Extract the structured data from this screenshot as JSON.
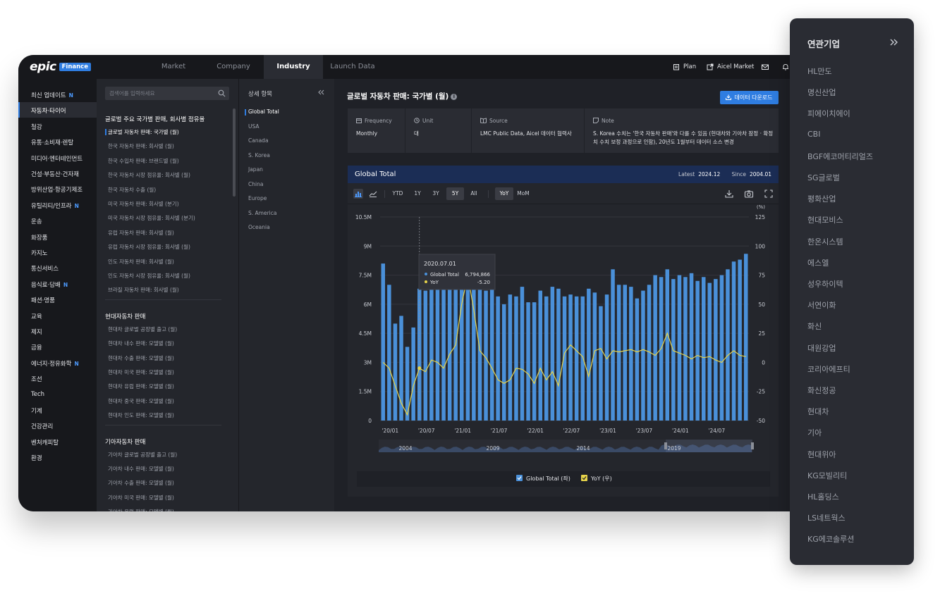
{
  "brand": {
    "name": "epic",
    "badge": "Finance"
  },
  "nav": {
    "tabs": [
      "Market",
      "Company",
      "Industry",
      "Launch Data"
    ]
  },
  "top_right": {
    "plan": "Plan",
    "aicel_market": "Aicel Market"
  },
  "left_menu": {
    "items": [
      {
        "label": "최신 업데이트",
        "badge": "N"
      },
      {
        "label": "자동차·타이어",
        "badge": ""
      },
      {
        "label": "철강",
        "badge": ""
      },
      {
        "label": "유통·소비재·렌탈",
        "badge": ""
      },
      {
        "label": "미디어·엔터테인먼트",
        "badge": ""
      },
      {
        "label": "건설·부동산·건자재",
        "badge": ""
      },
      {
        "label": "방위산업·항공기제조",
        "badge": ""
      },
      {
        "label": "유틸리티/인프라",
        "badge": "N"
      },
      {
        "label": "운송",
        "badge": ""
      },
      {
        "label": "화장품",
        "badge": ""
      },
      {
        "label": "카지노",
        "badge": ""
      },
      {
        "label": "통신서비스",
        "badge": ""
      },
      {
        "label": "음식료·담배",
        "badge": "N"
      },
      {
        "label": "패션·명품",
        "badge": ""
      },
      {
        "label": "교육",
        "badge": ""
      },
      {
        "label": "제지",
        "badge": ""
      },
      {
        "label": "금융",
        "badge": ""
      },
      {
        "label": "에너지·정유화학",
        "badge": "N"
      },
      {
        "label": "조선",
        "badge": ""
      },
      {
        "label": "Tech",
        "badge": ""
      },
      {
        "label": "기계",
        "badge": ""
      },
      {
        "label": "건강관리",
        "badge": ""
      },
      {
        "label": "벤처캐피탈",
        "badge": ""
      },
      {
        "label": "환경",
        "badge": ""
      }
    ]
  },
  "search": {
    "placeholder": "검색어를 입력하세요"
  },
  "list_groups": [
    {
      "title": "글로벌 주요 국가별 판매, 회사별 점유율",
      "items": [
        "글로벌 자동차 판매: 국가별 (월)",
        "한국 자동차 판매: 회사별 (월)",
        "한국 수입차 판매: 브랜드별 (월)",
        "한국 자동차 시장 점유율: 회사별 (월)",
        "한국 자동차 수출 (월)",
        "미국 자동차 판매: 회사별 (분기)",
        "미국 자동차 시장 점유율: 회사별 (분기)",
        "유럽 자동차 판매: 회사별 (월)",
        "유럽 자동차 시장 점유율: 회사별 (월)",
        "인도 자동차 판매: 회사별 (월)",
        "인도 자동차 시장 점유율: 회사별 (월)",
        "브라질 자동차 판매: 회사별 (월)"
      ]
    },
    {
      "title": "현대자동차 판매",
      "items": [
        "현대차 글로벌 공장별 출고 (월)",
        "현대차 내수 판매: 모델별 (월)",
        "현대차 수출 판매: 모델별 (월)",
        "현대차 미국 판매: 모델별 (월)",
        "현대차 유럽 판매: 모델별 (월)",
        "현대차 중국 판매: 모델별 (월)",
        "현대차 인도 판매: 모델별 (월)"
      ]
    },
    {
      "title": "기아자동차 판매",
      "items": [
        "기아차 글로벌 공장별 출고 (월)",
        "기아차 내수 판매: 모델별 (월)",
        "기아차 수출 판매: 모델별 (월)",
        "기아차 미국 판매: 모델별 (월)",
        "기아차 유럽 판매: 모델별 (월)"
      ]
    }
  ],
  "detail": {
    "title": "상세 항목",
    "items": [
      "Global Total",
      "USA",
      "Canada",
      "S. Korea",
      "Japan",
      "China",
      "Europe",
      "S. America",
      "Oceania"
    ]
  },
  "main": {
    "title": "글로벌 자동차 판매: 국가별 (월)",
    "info": "i",
    "download": "데이터 다운로드",
    "meta": [
      {
        "label": "Frequency",
        "value": "Monthly"
      },
      {
        "label": "Unit",
        "value": "대"
      },
      {
        "label": "Source",
        "value": "LMC Public Data, Aicel 데이터 협력사"
      },
      {
        "label": "Note",
        "value": "S. Korea 수치는 '한국 자동차 판매'와 다를 수 있음 (현대차와 기아차 잠정 · 확정",
        "value2": "치 수치 보정 과정으로 인함), 20년도 1월부터 데이터 소스 변경"
      }
    ]
  },
  "chart_header": {
    "title": "Global Total",
    "latest_label": "Latest",
    "latest": "2024.12",
    "since_label": "Since",
    "since": "2004.01"
  },
  "toolbar": {
    "ranges": [
      "YTD",
      "1Y",
      "3Y",
      "5Y",
      "All"
    ],
    "modes": [
      "YoY",
      "MoM"
    ]
  },
  "chart_data": {
    "type": "bar",
    "categories": [
      "2020-01",
      "2020-02",
      "2020-03",
      "2020-04",
      "2020-05",
      "2020-06",
      "2020-07",
      "2020-08",
      "2020-09",
      "2020-10",
      "2020-11",
      "2020-12",
      "2021-01",
      "2021-02",
      "2021-03",
      "2021-04",
      "2021-05",
      "2021-06",
      "2021-07",
      "2021-08",
      "2021-09",
      "2021-10",
      "2021-11",
      "2021-12",
      "2022-01",
      "2022-02",
      "2022-03",
      "2022-04",
      "2022-05",
      "2022-06",
      "2022-07",
      "2022-08",
      "2022-09",
      "2022-10",
      "2022-11",
      "2022-12",
      "2023-01",
      "2023-02",
      "2023-03",
      "2023-04",
      "2023-05",
      "2023-06",
      "2023-07",
      "2023-08",
      "2023-09",
      "2023-10",
      "2023-11",
      "2023-12",
      "2024-01",
      "2024-02",
      "2024-03",
      "2024-04",
      "2024-05",
      "2024-06",
      "2024-07",
      "2024-08",
      "2024-09",
      "2024-10",
      "2024-11",
      "2024-12"
    ],
    "x_tick_labels": [
      "'20/01",
      "'20/07",
      "'21/01",
      "'21/07",
      "'22/01",
      "'22/07",
      "'23/01",
      "'23/07",
      "'24/01",
      "'24/07"
    ],
    "series": [
      {
        "name": "Global Total",
        "axis": "left",
        "values": [
          8100000,
          7000000,
          5000000,
          5400000,
          3800000,
          4800000,
          6800000,
          6700000,
          6900000,
          7000000,
          7300000,
          7000000,
          7100000,
          6900000,
          7300000,
          7000000,
          8200000,
          6700000,
          6900000,
          6400000,
          6000000,
          6500000,
          6400000,
          6900000,
          6100000,
          6100000,
          6700000,
          6400000,
          6900000,
          6800000,
          6400000,
          6500000,
          6400000,
          6400000,
          6800000,
          6600000,
          5900000,
          6500000,
          7800000,
          7000000,
          7000000,
          6900000,
          6300000,
          6700000,
          7000000,
          7500000,
          7400000,
          7800000,
          7300000,
          7500000,
          7400000,
          7600000,
          7200000,
          7400000,
          7100000,
          7300000,
          7500000,
          7800000,
          8200000,
          8300000,
          8600000
        ]
      },
      {
        "name": "YoY",
        "axis": "right",
        "values": [
          0,
          -5,
          -20,
          -35,
          -45,
          -20,
          -5,
          -8,
          2,
          0,
          -5,
          7,
          15,
          50,
          75,
          45,
          10,
          4,
          -5,
          -15,
          -18,
          -15,
          -5,
          -6,
          -10,
          -18,
          -5,
          -15,
          -8,
          -20,
          8,
          15,
          10,
          5,
          -12,
          10,
          12,
          3,
          10,
          9,
          10,
          11,
          9,
          11,
          9,
          6,
          12,
          25,
          10,
          8,
          6,
          3,
          6,
          4,
          5,
          2,
          0,
          6,
          10,
          6,
          5
        ]
      }
    ],
    "yleft_ticks": [
      "0",
      "1.5M",
      "3M",
      "4.5M",
      "6M",
      "7.5M",
      "9M",
      "10.5M"
    ],
    "yleft_range": [
      0,
      10500000
    ],
    "yright_ticks": [
      "-50",
      "-25",
      "0",
      "25",
      "50",
      "75",
      "100",
      "125"
    ],
    "yright_range": [
      -50,
      125
    ],
    "yright_unit": "(%)",
    "tooltip": {
      "date": "2020.07.01",
      "series1_name": "Global Total",
      "series1_value": "6,794,866",
      "series2_name": "YoY",
      "series2_value": "-5.20"
    },
    "navigator_labels": [
      "2004",
      "2009",
      "2014",
      "2019"
    ],
    "legend": [
      "Global Total (좌)",
      "YoY (우)"
    ],
    "colors": {
      "bar": "#4a90d9",
      "line": "#e6d34a",
      "legend_check": "#4a90d9"
    }
  },
  "related": {
    "title": "연관기업",
    "companies": [
      "HL만도",
      "명신산업",
      "피에이치에이",
      "CBI",
      "BGF에코머티리얼즈",
      "SG글로벌",
      "평화산업",
      "현대모비스",
      "한온시스템",
      "에스엘",
      "성우하이텍",
      "서연이화",
      "화신",
      "대원강업",
      "코리아에프티",
      "화신정공",
      "현대차",
      "기아",
      "현대위아",
      "KG모빌리티",
      "HL홀딩스",
      "LS네트웍스",
      "KG에코솔루션"
    ]
  }
}
